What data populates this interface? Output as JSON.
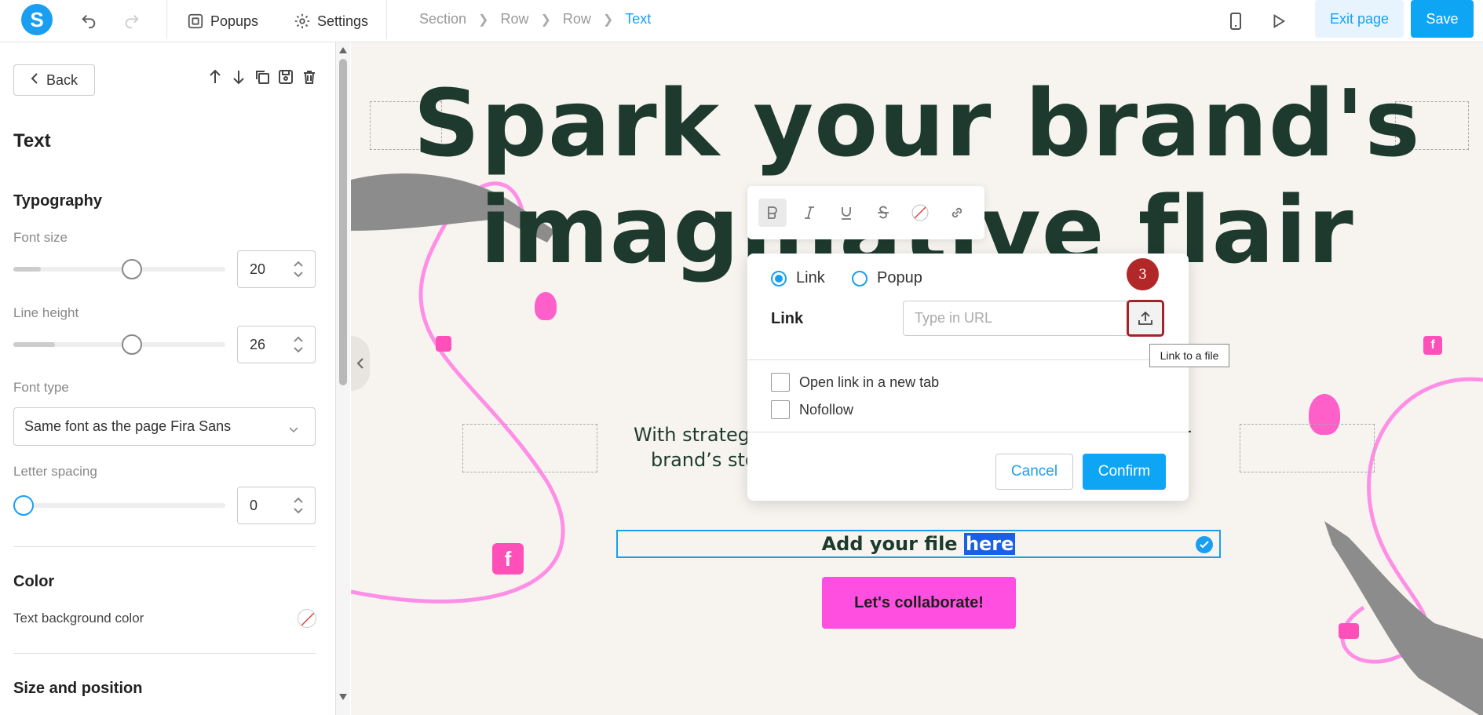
{
  "topbar": {
    "logo_letter": "S",
    "popups_label": "Popups",
    "settings_label": "Settings",
    "breadcrumb": [
      "Section",
      "Row",
      "Row",
      "Text"
    ],
    "exit_label": "Exit page",
    "save_label": "Save"
  },
  "sidebar": {
    "back_label": "Back",
    "title": "Text",
    "typography_heading": "Typography",
    "font_size": {
      "label": "Font size",
      "value": "20",
      "level": 0.42
    },
    "line_height": {
      "label": "Line height",
      "value": "26",
      "level": 0.42
    },
    "font_type": {
      "label": "Font type",
      "value": "Same font as the page Fira Sans"
    },
    "letter_spacing": {
      "label": "Letter spacing",
      "value": "0",
      "level": 0.0
    },
    "color_heading": "Color",
    "text_bg_label": "Text background color",
    "size_heading": "Size and position"
  },
  "canvas": {
    "headline_line1": "Spark your brand's",
    "headline_line2": "imaginative flair",
    "para_left_1": "With strategy",
    "para_left_2": "brand’s sto",
    "para_right": "r",
    "selected_text_before": "Add your file ",
    "selected_text_highlight": "here",
    "cta_label": "Let's collaborate!"
  },
  "dialog": {
    "radio_link": "Link",
    "radio_popup": "Popup",
    "link_label": "Link",
    "url_placeholder": "Type in URL",
    "badge": "3",
    "tooltip": "Link to a file",
    "new_tab_label": "Open link in a new tab",
    "nofollow_label": "Nofollow",
    "cancel_label": "Cancel",
    "confirm_label": "Confirm"
  },
  "colors": {
    "accent": "#1a9ff0",
    "cta": "#ff4fe0",
    "headline": "#1e3a2e",
    "badge": "#b22727"
  }
}
